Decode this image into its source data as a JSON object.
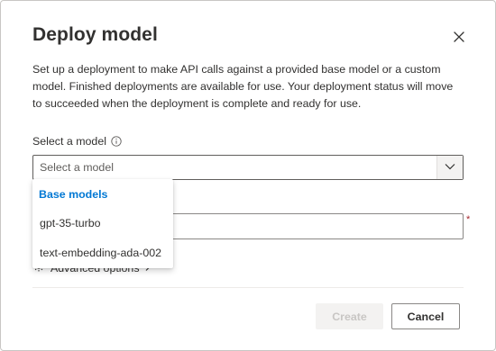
{
  "dialog": {
    "title": "Deploy model",
    "description": "Set up a deployment to make API calls against a provided base model or a custom model. Finished deployments are available for use. Your deployment status will move to succeeded when the deployment is complete and ready for use."
  },
  "model_field": {
    "label": "Select a model",
    "placeholder": "Select a model",
    "value": ""
  },
  "dropdown": {
    "group_header": "Base models",
    "options": [
      "gpt-35-turbo",
      "text-embedding-ada-002"
    ]
  },
  "second_field": {
    "required_marker": "*"
  },
  "advanced": {
    "label": "Advanced options"
  },
  "footer": {
    "create_label": "Create",
    "cancel_label": "Cancel"
  },
  "icons": {
    "close": "close-icon",
    "info": "info-icon",
    "chevron": "chevron-down-icon",
    "gear": "gear-icon"
  },
  "colors": {
    "accent": "#0078d4",
    "text": "#323130",
    "disabled_text": "#c8c6c4",
    "required": "#a4262c"
  }
}
